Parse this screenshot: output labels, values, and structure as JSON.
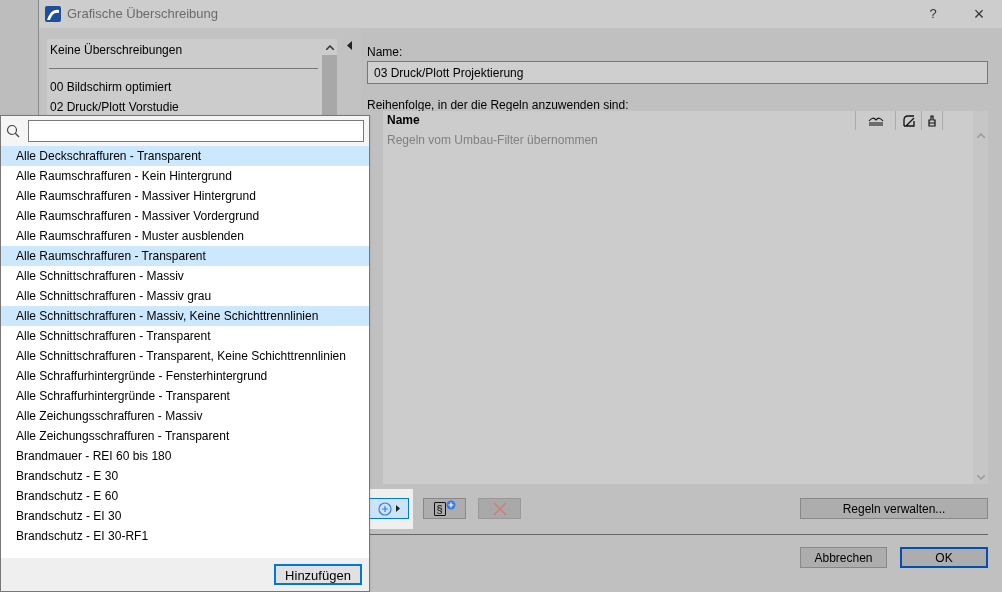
{
  "window": {
    "title": "Grafische Überschreibung",
    "help": "?",
    "close": "×"
  },
  "override_list": {
    "items": [
      {
        "label": "Keine Überschreibungen",
        "kind": "none"
      },
      {
        "label": "00 Bildschirm optimiert",
        "kind": "combination"
      },
      {
        "label": "02 Druck/Plott Vorstudie",
        "kind": "combination"
      }
    ]
  },
  "name_field": {
    "label": "Name:",
    "value": "03 Druck/Plott Projektierung"
  },
  "rules_table": {
    "label": "Reihenfolge, in der die Regeln anzuwenden sind:",
    "columns": [
      "Name"
    ],
    "rows": [
      {
        "text": "Regeln vom Umbau-Filter übernommen",
        "disabled": true
      }
    ]
  },
  "toolbar": {
    "add_rule_open": true,
    "section_symbol": "§",
    "delete_disabled": true,
    "manage_button": "Regeln verwalten..."
  },
  "footer": {
    "cancel": "Abbrechen",
    "ok": "OK"
  },
  "rule_popup": {
    "items": [
      {
        "label": "Alle Deckschraffuren - Transparent",
        "selected": true
      },
      {
        "label": "Alle Raumschraffuren - Kein Hintergrund",
        "selected": false
      },
      {
        "label": "Alle Raumschraffuren - Massiver Hintergrund",
        "selected": false
      },
      {
        "label": "Alle Raumschraffuren - Massiver Vordergrund",
        "selected": false
      },
      {
        "label": "Alle Raumschraffuren - Muster ausblenden",
        "selected": false
      },
      {
        "label": "Alle Raumschraffuren - Transparent",
        "selected": true
      },
      {
        "label": "Alle Schnittschraffuren - Massiv",
        "selected": false
      },
      {
        "label": "Alle Schnittschraffuren - Massiv grau",
        "selected": false
      },
      {
        "label": "Alle Schnittschraffuren - Massiv, Keine Schichttrennlinien",
        "selected": true
      },
      {
        "label": "Alle Schnittschraffuren - Transparent",
        "selected": false
      },
      {
        "label": "Alle Schnittschraffuren - Transparent, Keine Schichttrennlinien",
        "selected": false
      },
      {
        "label": "Alle Schraffurhintergründe - Fensterhintergrund",
        "selected": false
      },
      {
        "label": "Alle Schraffurhintergründe - Transparent",
        "selected": false
      },
      {
        "label": "Alle Zeichungsschraffuren - Massiv",
        "selected": false
      },
      {
        "label": "Alle Zeichungsschraffuren - Transparent",
        "selected": false
      },
      {
        "label": "Brandmauer - REI 60 bis 180",
        "selected": false
      },
      {
        "label": "Brandschutz - E 30",
        "selected": false
      },
      {
        "label": "Brandschutz - E 60",
        "selected": false
      },
      {
        "label": "Brandschutz - EI 30",
        "selected": false
      },
      {
        "label": "Brandschutz - EI 30-RF1",
        "selected": false
      }
    ],
    "add_button": "Hinzufügen"
  }
}
